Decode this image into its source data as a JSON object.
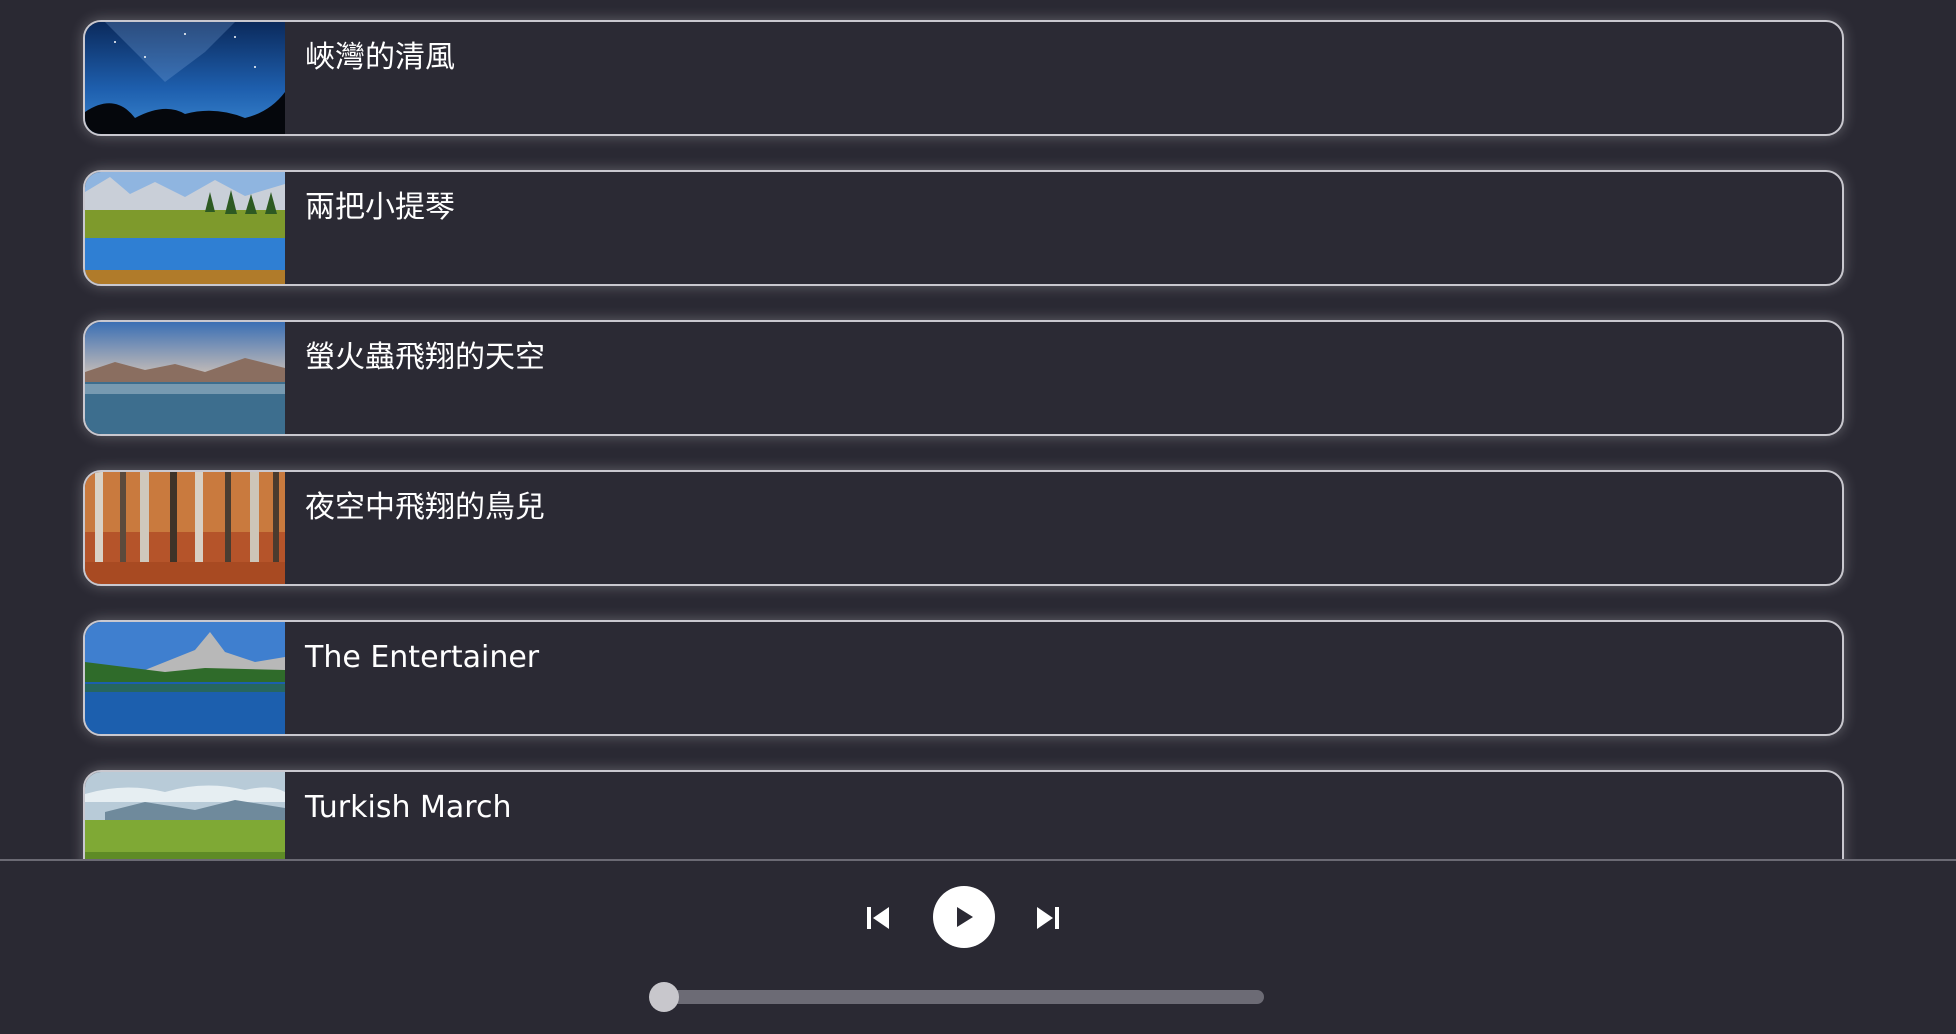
{
  "playlist": {
    "tracks": [
      {
        "title": "峽灣的清風",
        "thumbnail": "starry-night-sky-image"
      },
      {
        "title": "兩把小提琴",
        "thumbnail": "mountain-lake-reflection-image"
      },
      {
        "title": "螢火蟲飛翔的天空",
        "thumbnail": "calm-lake-mountains-image"
      },
      {
        "title": "夜空中飛翔的鳥兒",
        "thumbnail": "autumn-forest-image"
      },
      {
        "title": "The Entertainer",
        "thumbnail": "alpine-lake-peak-image"
      },
      {
        "title": "Turkish March",
        "thumbnail": "green-meadow-image"
      }
    ]
  },
  "player": {
    "controls": {
      "previous_icon": "skip-previous-icon",
      "play_icon": "play-icon",
      "next_icon": "skip-next-icon"
    },
    "progress": 0.0
  },
  "colors": {
    "background": "#2a2933",
    "card_border": "#c9c8cf",
    "text": "#ffffff",
    "progress_track": "#6c6b75",
    "progress_thumb": "#c8c7cc"
  }
}
